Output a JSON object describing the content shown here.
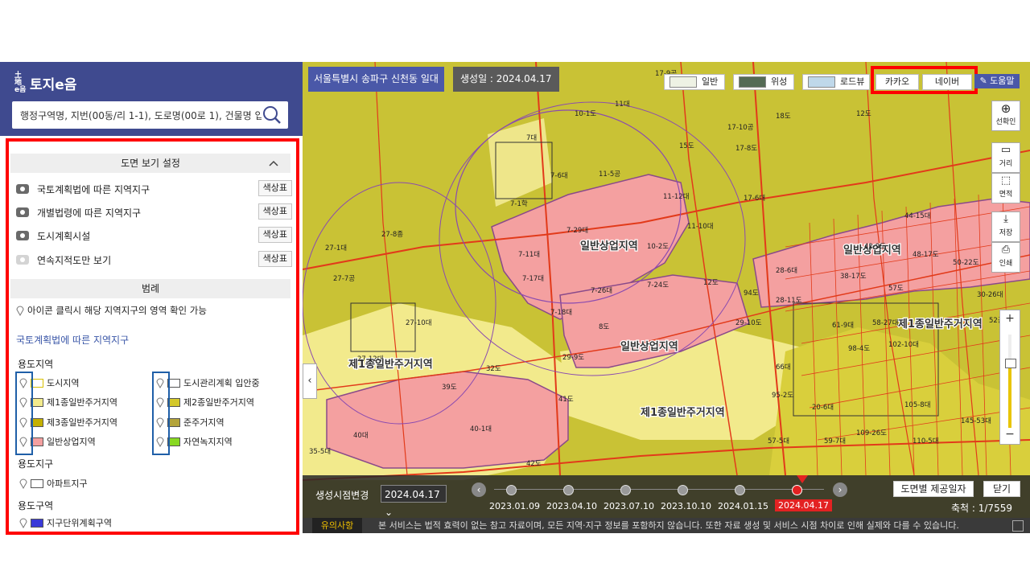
{
  "app": {
    "logo_mark": "土地 e음",
    "logo_text": "토지e음"
  },
  "search": {
    "placeholder": "행정구역명, 지번(00동/리 1-1), 도로명(00로 1), 건물명 입력"
  },
  "view_settings": {
    "title": "도면 보기 설정",
    "collapse_icon": "chevron-up-icon",
    "color_button": "색상표",
    "layers": [
      {
        "label": "국토계획법에 따른 지역지구",
        "visible": true
      },
      {
        "label": "개별법령에 따른 지역지구",
        "visible": true
      },
      {
        "label": "도시계획시설",
        "visible": true
      },
      {
        "label": "연속지적도만 보기",
        "visible": false
      }
    ]
  },
  "legend": {
    "title": "범례",
    "info": "아이콘 클릭시 해당 지역지구의 영역 확인 가능",
    "subtitle": "국토계획법에 따른 지역지구",
    "use_area_title": "용도지역",
    "left_items": [
      {
        "label": "도시지역",
        "color": "#ffffff",
        "border": "#d8c000"
      },
      {
        "label": "제1종일반주거지역",
        "color": "#f2ea8c",
        "border": "#555555"
      },
      {
        "label": "제3종일반주거지역",
        "color": "#c4b000",
        "border": "#555555"
      },
      {
        "label": "일반상업지역",
        "color": "#f4a0a0",
        "border": "#555555"
      }
    ],
    "right_items": [
      {
        "label": "도시관리계획 입안중",
        "color": "#ffffff",
        "border": "#555555"
      },
      {
        "label": "제2종일반주거지역",
        "color": "#d4c82a",
        "border": "#555555"
      },
      {
        "label": "준주거지역",
        "color": "#b4a43a",
        "border": "#555555"
      },
      {
        "label": "자연녹지지역",
        "color": "#88d822",
        "border": "#555555"
      }
    ],
    "district_title": "용도지구",
    "district_item": "아파트지구",
    "zone_title": "용도구역",
    "zone_item_partial": "지구단위계획구역"
  },
  "map": {
    "location": "서울특별시 송파구 신천동 일대",
    "created": "생성일 : 2024.04.17",
    "map_types": [
      {
        "label": "일반",
        "icon": "map-general-icon"
      },
      {
        "label": "위성",
        "icon": "map-satellite-icon"
      },
      {
        "label": "로드뷰",
        "icon": "map-roadview-icon"
      }
    ],
    "providers": [
      "카카오",
      "네이버"
    ],
    "help": "도움말",
    "tools": [
      {
        "label": "선확인",
        "icon": "zoom-target-icon"
      },
      {
        "label": "거리",
        "icon": "ruler-icon"
      },
      {
        "label": "면적",
        "icon": "area-icon"
      },
      {
        "label": "저장",
        "icon": "download-icon"
      },
      {
        "label": "인쇄",
        "icon": "print-icon"
      }
    ],
    "zoom_in": "+",
    "zoom_out": "−",
    "zones": {
      "commercial_1": "일반상업지역",
      "commercial_2": "일반상업지역",
      "residential_1": "제1종일반주거지역",
      "residential_2": "제1종일반주거지역",
      "residential_3": "제1종일반주거지역"
    },
    "lots": [
      "17-9공",
      "10-1도",
      "11대",
      "18도",
      "12도",
      "17-10공",
      "17-8도",
      "15도",
      "7대",
      "7-6대",
      "11-5공",
      "7-1학",
      "11-12대",
      "17-6대",
      "7-29대",
      "11-10대",
      "27-8종",
      "10-2도",
      "7-11대",
      "27-1대",
      "7-17대",
      "7-24도",
      "27-7공",
      "7-26대",
      "12도",
      "7-18대",
      "8도",
      "27-10대",
      "29-9도",
      "29-10도",
      "27-12대",
      "32도",
      "39도",
      "41도",
      "40대",
      "40-1대",
      "42도",
      "35-5대",
      "44-15대",
      "42-9도",
      "48-17도",
      "50-22도",
      "28-6대",
      "38-17도",
      "94도",
      "28-11도",
      "57도",
      "30-26대",
      "52공",
      "58-27대",
      "61-9대",
      "102-10대",
      "98-4도",
      "66대",
      "95-2도",
      "105-8대",
      "109-26도",
      "110-5대",
      "145-53대",
      "57-5대",
      "59-7대",
      "20-6대"
    ]
  },
  "timeline": {
    "label": "생성시점변경",
    "selected": "2024.04.17",
    "dates": [
      "2023.01.09",
      "2023.04.10",
      "2023.07.10",
      "2023.10.10",
      "2024.01.15",
      "2024.04.17"
    ],
    "active_index": 5,
    "provide_date_button": "도면별 제공일자",
    "close_button": "닫기",
    "scale": "축척 : 1/7559"
  },
  "notice": {
    "tag": "유의사항",
    "message": "본 서비스는 법적 효력이 없는 참고 자료이며, 모든 지역·지구 정보를 포함하지 않습니다. 또한 자료 생성 및 서비스 시점 차이로 인해 실제와 다를 수 있습니다."
  },
  "colors": {
    "header": "#3f4a8f",
    "highlight": "#ff0000",
    "commercial": "#f4a0a0",
    "residential": "#c9c235",
    "active_date": "#e32222"
  }
}
